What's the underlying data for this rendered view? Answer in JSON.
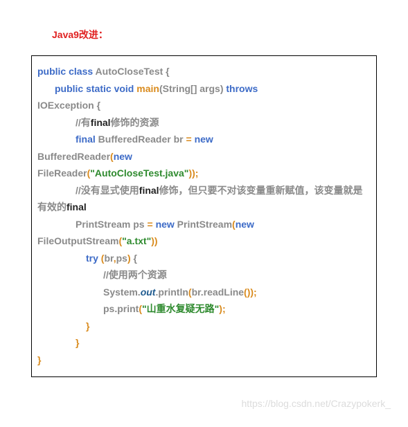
{
  "title": "Java9改进：",
  "code": {
    "l1_public": "public class",
    "l1_class": " AutoCloseTest {",
    "l2_mod": "public static void",
    "l2_main": " main",
    "l2_args": "(String[] args)",
    "l2_throws": " throws",
    "l3_ex": "IOException {",
    "l4_comment1": "//有",
    "l4_final": "final",
    "l4_comment2": "修饰的资源",
    "l5_final": "final",
    "l5_br": " BufferedReader br ",
    "l5_eq": "= ",
    "l5_new": "new",
    "l6_ctor": "BufferedReader",
    "l6_paren": "(",
    "l6_new": "new",
    "l7_ctor": "FileReader",
    "l7_paren": "(",
    "l7_str": "\"AutoCloseTest.java\"",
    "l7_end": "));",
    "l8_comment1": "//没有显式使用",
    "l8_final": "final",
    "l8_comment2": "修饰，但只要不对该变量重新赋值，该变量就是有效的",
    "l8_final2": "final",
    "l9_ps": "PrintStream ps ",
    "l9_eq": "= ",
    "l9_new": "new",
    "l9_ctor": " PrintStream",
    "l9_paren": "(",
    "l9_new2": "new",
    "l10_ctor": "FileOutputStream",
    "l10_paren": "(",
    "l10_str": "\"a.txt\"",
    "l10_end": "))",
    "l11_try": "try",
    "l11_paren1": " (",
    "l11_br": "br",
    "l11_comma": ",",
    "l11_ps": "ps",
    "l11_paren2": ")",
    "l11_brace": " {",
    "l12_comment": "//使用两个资源",
    "l13_sys": "System.",
    "l13_out": "out",
    "l13_println": ".println",
    "l13_paren": "(",
    "l13_readline": "br.readLine",
    "l13_end": "());",
    "l14_ps": "ps.print",
    "l14_paren": "(",
    "l14_str": "\"山重水复疑无路\"",
    "l14_end": ");",
    "l15_brace": "}",
    "l16_brace": "}",
    "l17_brace": "}"
  },
  "watermark": "https://blog.csdn.net/Crazypokerk_"
}
